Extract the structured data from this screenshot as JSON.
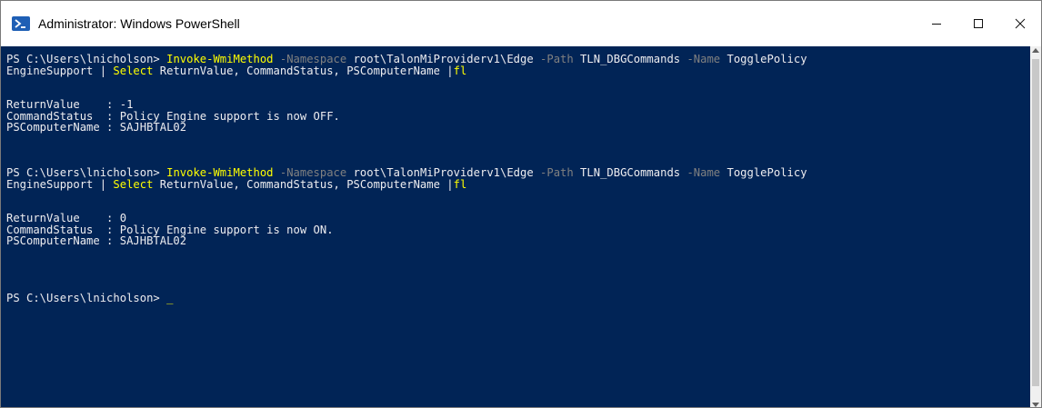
{
  "window": {
    "title": "Administrator: Windows PowerShell",
    "controls": {
      "minimize": "—",
      "maximize": "☐",
      "close": "✕"
    }
  },
  "colors": {
    "background": "#012456",
    "text": "#eeedf0",
    "command": "#ffff00",
    "parameter": "#808080"
  },
  "console": {
    "block1": {
      "prompt": "PS C:\\Users\\lnicholson> ",
      "cmdlet": "Invoke-WmiMethod",
      "p_namespace": " -Namespace",
      "v_namespace": " root\\TalonMiProviderv1\\Edge",
      "p_path": " -Path",
      "v_path": " TLN_DBGCommands",
      "p_name": " -Name",
      "v_name_part1": " TogglePolicy",
      "v_name_part2": "EngineSupport",
      "pipe": " | ",
      "select": "Select",
      "select_args": " ReturnValue, CommandStatus, PSComputerName |",
      "fl": "fl",
      "output": [
        "ReturnValue    : -1",
        "CommandStatus  : Policy Engine support is now OFF.",
        "PSComputerName : SAJHBTAL02"
      ]
    },
    "block2": {
      "prompt": "PS C:\\Users\\lnicholson> ",
      "cmdlet": "Invoke-WmiMethod",
      "p_namespace": " -Namespace",
      "v_namespace": " root\\TalonMiProviderv1\\Edge",
      "p_path": " -Path",
      "v_path": " TLN_DBGCommands",
      "p_name": " -Name",
      "v_name_part1": " TogglePolicy",
      "v_name_part2": "EngineSupport",
      "pipe": " | ",
      "select": "Select",
      "select_args": " ReturnValue, CommandStatus, PSComputerName |",
      "fl": "fl",
      "output": [
        "ReturnValue    : 0",
        "CommandStatus  : Policy Engine support is now ON.",
        "PSComputerName : SAJHBTAL02"
      ]
    },
    "final_prompt": "PS C:\\Users\\lnicholson> ",
    "cursor": "_"
  }
}
